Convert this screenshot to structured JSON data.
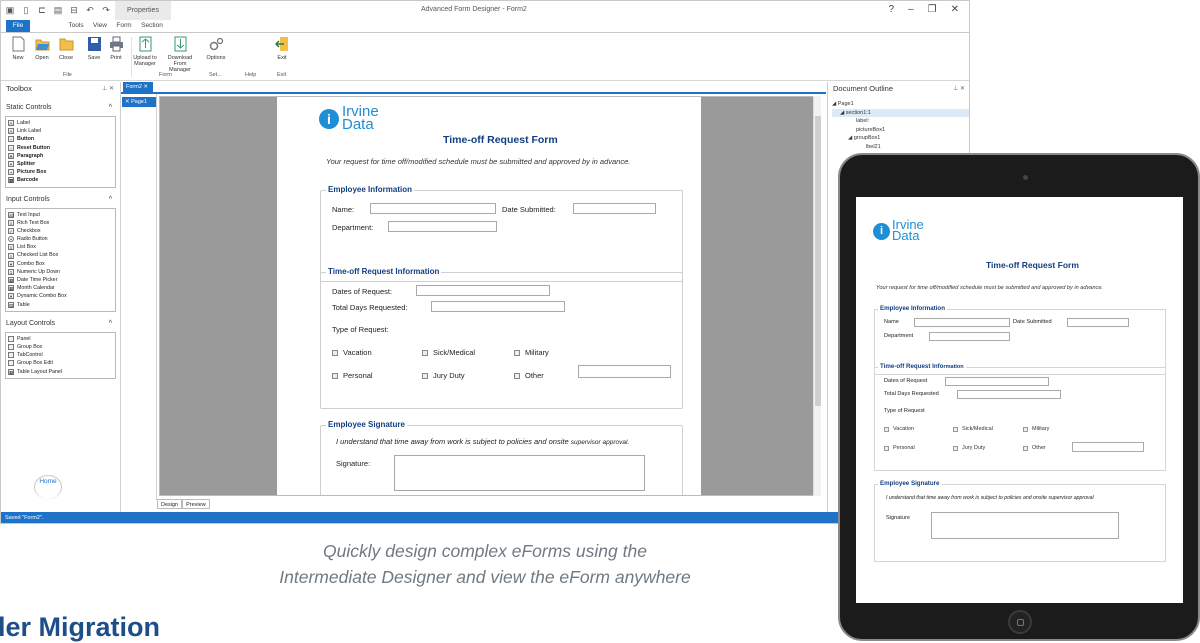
{
  "app": {
    "window_title": "Advanced Form Designer - Form2",
    "context_tab": "Properties",
    "tabs": [
      "File",
      "Home",
      "Tools",
      "View",
      "Form",
      "Section"
    ],
    "ribbon": {
      "buttons": {
        "new": "New",
        "open": "Open",
        "close": "Close",
        "save": "Save",
        "print": "Print",
        "upload": "Upload to Manager",
        "download": "Download From Manager",
        "options": "Options",
        "exit": "Exit"
      },
      "groups": {
        "file": "File",
        "form": "Form",
        "settings": "Set...",
        "help": "Help",
        "exit": "Exit"
      }
    },
    "toolbox": {
      "title": "Toolbox",
      "static_title": "Static Controls",
      "static_items": [
        "Label",
        "Link Label",
        "Button",
        "Reset Button",
        "Paragraph",
        "Splitter",
        "Picture Box",
        "Barcode"
      ],
      "input_title": "Input Controls",
      "input_items": [
        "Text Input",
        "Rich Text Box",
        "Checkbox",
        "Radio Button",
        "List Box",
        "Checked List Box",
        "Combo Box",
        "Numeric Up Down",
        "Date Time Picker",
        "Month Calendar",
        "Dynamic Combo Box",
        "Table"
      ],
      "layout_title": "Layout Controls",
      "layout_items": [
        "Panel",
        "Group Box",
        "TabControl",
        "Group Box Edit",
        "Table Layout Panel"
      ]
    },
    "doc_tab": "Form2",
    "page_tab": "Page1",
    "bottom_tabs": [
      "Design",
      "Preview"
    ],
    "status": "Saved \"Form2\".",
    "outline": {
      "title": "Document Outline",
      "nodes": [
        "Page1",
        "section1:1",
        "label:",
        "pictureBox1",
        "groupBox1",
        "lbel21"
      ]
    }
  },
  "form": {
    "logo_line1": "Irvine",
    "logo_line2": "Data",
    "title": "Time-off Request Form",
    "intro": "Your request for time off/modified schedule must be submitted and approved by in advance.",
    "emp": {
      "legend": "Employee Information",
      "name": "Name:",
      "date_submitted": "Date Submitted:",
      "department": "Department:"
    },
    "req": {
      "legend": "Time-off Request Information",
      "dates": "Dates of Request:",
      "total": "Total Days Requested:",
      "type": "Type of Request:",
      "options": [
        "Vacation",
        "Sick/Medical",
        "Military",
        "Personal",
        "Jury Duty",
        "Other"
      ]
    },
    "sig": {
      "legend": "Employee Signature",
      "statement_a": "I understand that time away from work is subject to policies and onsite",
      "statement_b": "supervisor approval.",
      "signature": "Signature:"
    }
  },
  "tablet_form": {
    "emp": {
      "name": "Name",
      "date_submitted": "Date Submitted",
      "department": "Department"
    },
    "req": {
      "legend_a": "Time-off Request Info",
      "legend_b": "rmation",
      "dates": "Dates of Request",
      "total": "Total Days Requested",
      "type": "Type of Request"
    },
    "sig": {
      "statement": "I understand that time away from work is subject to policies and onsite supervisor approval",
      "signature": "Signature"
    }
  },
  "caption": {
    "line1": "Quickly design complex eForms using the",
    "line2": "Intermediate Designer and view the eForm anywhere"
  },
  "brand_fragment": "ler Migration",
  "colors": {
    "accent": "#1e73c8",
    "form_heading": "#123e80",
    "logo": "#1e8fd6",
    "caption": "#707a82"
  }
}
